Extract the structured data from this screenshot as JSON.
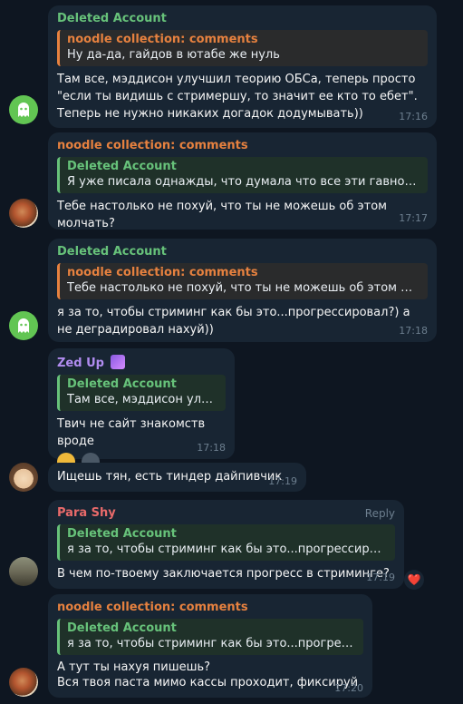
{
  "messages": [
    {
      "sender": "Deleted Account",
      "quote": {
        "name": "noodle collection: comments",
        "text": "Ну да-да, гайдов в ютабе же нуль"
      },
      "text": "Там все, мэддисон улучшил теорию ОБСа, теперь просто \"если ты видишь с стримершу, то значит ее кто то ебет\". Теперь не нужно никаких догадок додумывать))",
      "time": "17:16"
    },
    {
      "sender": "noodle collection: comments",
      "quote": {
        "name": "Deleted Account",
        "text": "Я уже писала однажды, что думала что все эти гавностримы ..."
      },
      "text": "Тебе настолько не похуй, что ты не можешь об этом молчать?",
      "time": "17:17"
    },
    {
      "sender": "Deleted Account",
      "quote": {
        "name": "noodle collection: comments",
        "text": "Тебе настолько не похуй, что ты не можешь об этом молчат..."
      },
      "text": "я за то, чтобы стриминг как бы это...прогрессировал?)  а не деградировал нахуй))",
      "time": "17:18"
    },
    {
      "sender": "Zed Up",
      "quote": {
        "name": "Deleted Account",
        "text": "Там все, мэддисон улучш..."
      },
      "text": "Твич не сайт знакомств вроде",
      "time": "17:18"
    },
    {
      "text": "Ищешь тян, есть тиндер дайпивчик",
      "time": "17:19"
    },
    {
      "sender": "Para Shy",
      "reply": "Reply",
      "quote": {
        "name": "Deleted Account",
        "text": "я за то, чтобы стриминг как бы это...прогрессировал?)  ..."
      },
      "text": "В чем по-твоему заключается прогресс в стриминге?",
      "time": "17:19",
      "reaction": "❤️"
    },
    {
      "sender": "noodle collection: comments",
      "quote": {
        "name": "Deleted Account",
        "text": "я за то, чтобы стриминг как бы это...прогрессиров..."
      },
      "text": "А тут ты нахуя пишешь?\nВся твоя паста мимо кассы проходит, фиксируй",
      "time": "17:20"
    }
  ],
  "colors": {
    "background": "#0e1621",
    "bubble": "#182533",
    "green": "#67c27a",
    "orange": "#e6813f",
    "purple": "#b18cf0",
    "red": "#e86a6a"
  }
}
